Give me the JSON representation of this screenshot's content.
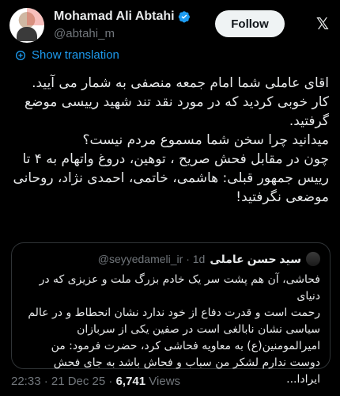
{
  "author": {
    "name": "Mohamad Ali Abtahi",
    "handle": "@abtahi_m",
    "follow_label": "Follow",
    "x_icon": "x-logo-icon"
  },
  "translate_label": "Show translation",
  "tweet": {
    "lines": [
      "اقای عاملی شما امام جمعه منصفی به شمار می آیید.",
      "کار خوبی کردید که در مورد نقد تند شهید رییسی موضع",
      "گرفتید.",
      "میدانید چرا سخن شما مسموع مردم نیست؟",
      "چون در مقابل فحش صریح ، توهین، دروغ واتهام به ۴ تا",
      "رییس جمهور قبلی: هاشمی، خاتمی، احمدی نژاد، روحانی",
      "موضعی نگرفتید!"
    ]
  },
  "quote": {
    "name": "سید حسن عاملی",
    "handle": "@seyyedameli_ir · 1d",
    "lines": [
      "فحاشی، آن هم پشت سر یک خادم بزرگ ملت و عزیزی که در دنیای",
      "رحمت است و قدرت دفاع از خود ندارد نشان انحطاط و در عالم",
      "سیاسی نشان نابالغی است در صفین یکی از سربازان",
      "امیرالمومنین(ع) به معاویه فحاشی کرد، حضرت فرمود: من",
      "دوست ندارم لشکر من سباب و فحاش باشد به جای فحش ایرادا..."
    ]
  },
  "meta": {
    "time_date": "22:33 · 21 Dec 25 · ",
    "views_count": "6,741",
    "views_label": " Views"
  }
}
